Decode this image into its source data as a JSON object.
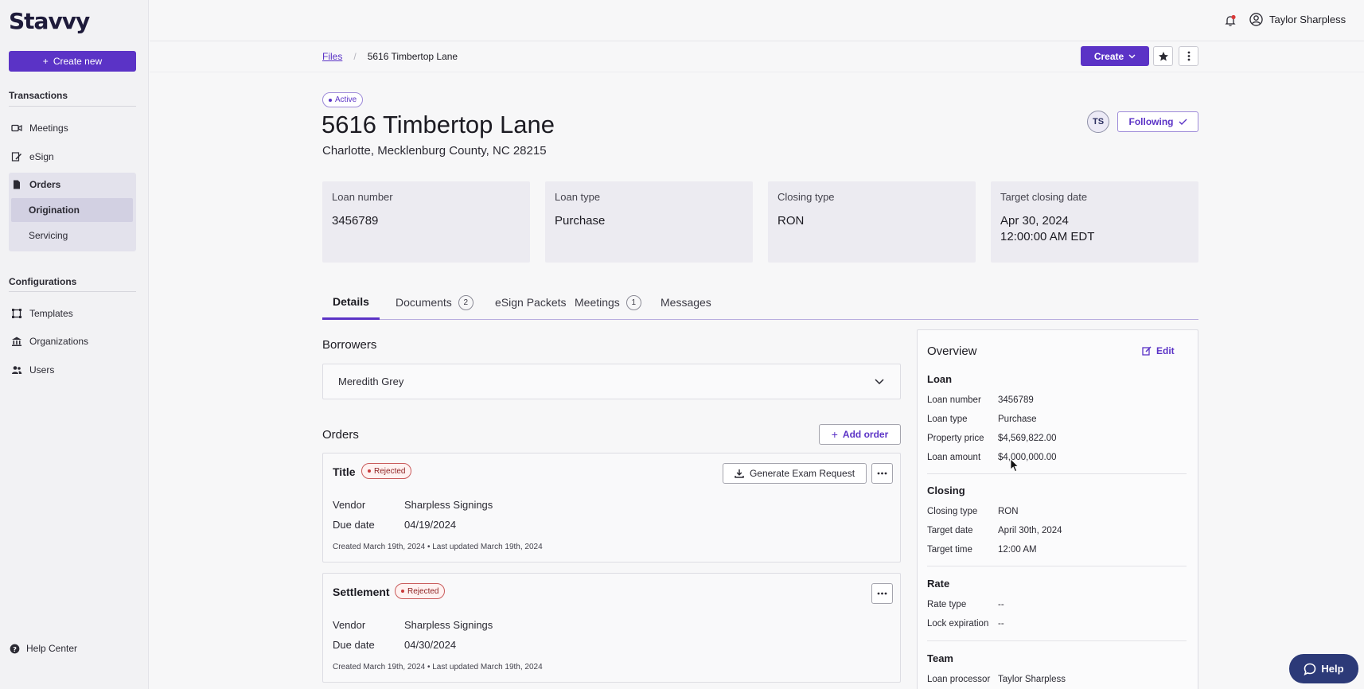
{
  "app": {
    "logo": "Stavvy",
    "create_new_label": "Create new"
  },
  "sidebar": {
    "transactions_title": "Transactions",
    "configurations_title": "Configurations",
    "items": [
      {
        "label": "Meetings",
        "icon": "video-icon"
      },
      {
        "label": "eSign",
        "icon": "sign-icon"
      },
      {
        "label": "Orders",
        "icon": "document-icon"
      },
      {
        "label": "Templates",
        "icon": "template-icon"
      },
      {
        "label": "Organizations",
        "icon": "building-icon"
      },
      {
        "label": "Users",
        "icon": "users-icon"
      }
    ],
    "orders_sub": [
      {
        "label": "Origination",
        "active": true
      },
      {
        "label": "Servicing",
        "active": false
      }
    ],
    "help_center": "Help Center"
  },
  "topbar": {
    "user_name": "Taylor Sharpless"
  },
  "breadcrumb": {
    "root": "Files",
    "current": "5616 Timbertop Lane"
  },
  "header": {
    "create_label": "Create",
    "status": "Active",
    "title": "5616 Timbertop Lane",
    "subtitle": "Charlotte, Mecklenburg County, NC 28215",
    "avatar_initials": "TS",
    "following_label": "Following"
  },
  "summary_cards": [
    {
      "label": "Loan number",
      "value": "3456789"
    },
    {
      "label": "Loan type",
      "value": "Purchase"
    },
    {
      "label": "Closing type",
      "value": "RON"
    },
    {
      "label": "Target closing date",
      "value_line1": "Apr 30, 2024",
      "value_line2": "12:00:00 AM EDT"
    }
  ],
  "tabs": [
    {
      "label": "Details",
      "active": true
    },
    {
      "label": "Documents",
      "count": "2"
    },
    {
      "label": "eSign Packets"
    },
    {
      "label": "Meetings",
      "count": "1"
    },
    {
      "label": "Messages"
    }
  ],
  "borrowers": {
    "title": "Borrowers",
    "selected": "Meredith Grey"
  },
  "orders": {
    "title": "Orders",
    "add_label": "Add order",
    "items": [
      {
        "title": "Title",
        "status": "Rejected",
        "action_label": "Generate Exam Request",
        "vendor_key": "Vendor",
        "vendor": "Sharpless Signings",
        "due_key": "Due date",
        "due": "04/19/2024",
        "meta": "Created March 19th, 2024 • Last updated March 19th, 2024"
      },
      {
        "title": "Settlement",
        "status": "Rejected",
        "vendor_key": "Vendor",
        "vendor": "Sharpless Signings",
        "due_key": "Due date",
        "due": "04/30/2024",
        "meta": "Created March 19th, 2024 • Last updated March 19th, 2024"
      }
    ]
  },
  "overview": {
    "title": "Overview",
    "edit_label": "Edit",
    "sections": {
      "loan": {
        "title": "Loan",
        "rows": [
          {
            "k": "Loan number",
            "v": "3456789"
          },
          {
            "k": "Loan type",
            "v": "Purchase"
          },
          {
            "k": "Property price",
            "v": "$4,569,822.00"
          },
          {
            "k": "Loan amount",
            "v": "$4,000,000.00"
          }
        ]
      },
      "closing": {
        "title": "Closing",
        "rows": [
          {
            "k": "Closing type",
            "v": "RON"
          },
          {
            "k": "Target date",
            "v": "April 30th, 2024"
          },
          {
            "k": "Target time",
            "v": "12:00 AM"
          }
        ]
      },
      "rate": {
        "title": "Rate",
        "rows": [
          {
            "k": "Rate type",
            "v": "--"
          },
          {
            "k": "Lock expiration",
            "v": "--"
          }
        ]
      },
      "team": {
        "title": "Team",
        "rows": [
          {
            "k": "Loan processor",
            "v": "Taylor Sharpless"
          }
        ]
      }
    }
  },
  "help_widget": {
    "label": "Help"
  },
  "colors": {
    "accent": "#5b33c6",
    "rejected": "#c95b5b",
    "help": "#2c3a78"
  }
}
